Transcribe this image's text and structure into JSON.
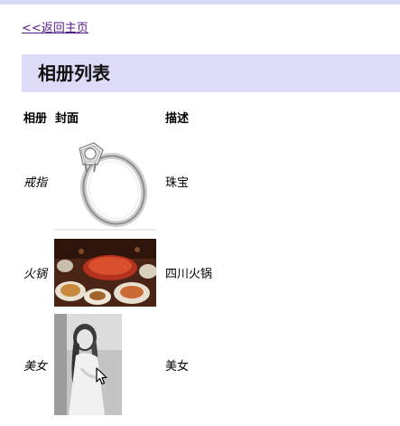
{
  "nav": {
    "back_label": "<<返回主页"
  },
  "page": {
    "title": "相册列表"
  },
  "table": {
    "headers": [
      "相册",
      "封面",
      "描述"
    ],
    "rows": [
      {
        "album": "戒指",
        "cover": "ring-image",
        "description": "珠宝"
      },
      {
        "album": "火锅",
        "cover": "hotpot-image",
        "description": "四川火锅"
      },
      {
        "album": "美女",
        "cover": "portrait-image",
        "description": "美女"
      }
    ]
  },
  "colors": {
    "top_bar": "#d8d8f6",
    "title_bar": "#dcdcf8",
    "link": "#551a8b"
  }
}
